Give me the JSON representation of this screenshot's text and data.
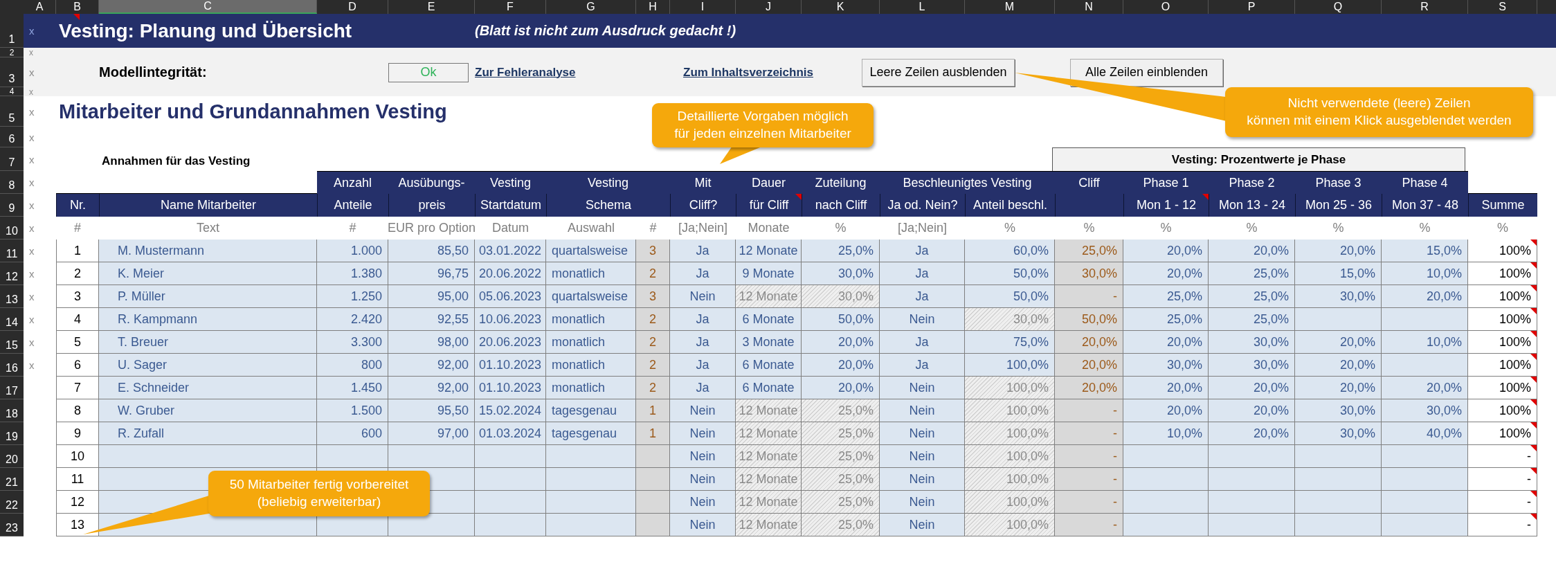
{
  "column_headers": [
    {
      "label": "A",
      "selected": false
    },
    {
      "label": "B",
      "selected": false
    },
    {
      "label": "C",
      "selected": true
    },
    {
      "label": "D",
      "selected": false
    },
    {
      "label": "E",
      "selected": false
    },
    {
      "label": "F",
      "selected": false
    },
    {
      "label": "G",
      "selected": false
    },
    {
      "label": "H",
      "selected": false
    },
    {
      "label": "I",
      "selected": false
    },
    {
      "label": "J",
      "selected": false
    },
    {
      "label": "K",
      "selected": false
    },
    {
      "label": "L",
      "selected": false
    },
    {
      "label": "M",
      "selected": false
    },
    {
      "label": "N",
      "selected": false
    },
    {
      "label": "O",
      "selected": false
    },
    {
      "label": "P",
      "selected": false
    },
    {
      "label": "Q",
      "selected": false
    },
    {
      "label": "R",
      "selected": false
    },
    {
      "label": "S",
      "selected": false
    }
  ],
  "row_headers": [
    {
      "label": "1",
      "marker": "x"
    },
    {
      "label": "2",
      "marker": "x"
    },
    {
      "label": "3",
      "marker": "x"
    },
    {
      "label": "4",
      "marker": "x"
    },
    {
      "label": "5",
      "marker": "x"
    },
    {
      "label": "6",
      "marker": "x"
    },
    {
      "label": "7",
      "marker": "x"
    },
    {
      "label": "8",
      "marker": "x"
    },
    {
      "label": "9",
      "marker": "x"
    },
    {
      "label": "10",
      "marker": "x"
    },
    {
      "label": "11",
      "marker": "x"
    },
    {
      "label": "12",
      "marker": "x"
    },
    {
      "label": "13",
      "marker": "x"
    },
    {
      "label": "14",
      "marker": "x"
    },
    {
      "label": "15",
      "marker": "x"
    },
    {
      "label": "16",
      "marker": "x"
    },
    {
      "label": "17"
    },
    {
      "label": "18"
    },
    {
      "label": "19"
    },
    {
      "label": "20"
    },
    {
      "label": "21"
    },
    {
      "label": "22"
    },
    {
      "label": "23"
    }
  ],
  "title_comment": true,
  "title": "Vesting: Planung und Übersicht",
  "subtitle": "(Blatt ist nicht zum Ausdruck gedacht !)",
  "controls": {
    "label": "Modellintegrität:",
    "status": "Ok",
    "links": [
      "Zur Fehleranalyse",
      "Zum Inhaltsverzeichnis"
    ],
    "buttons": [
      "Leere Zeilen ausblenden",
      "Alle Zeilen einblenden"
    ]
  },
  "section_title": "Mitarbeiter und Grundannahmen Vesting",
  "subsection_title": "Annahmen für das Vesting",
  "phase_group_title": "Vesting: Prozentwerte je Phase",
  "table": {
    "header_groups": [
      {
        "columns": [
          {
            "label": "Nr.",
            "comment": false
          }
        ]
      },
      {
        "columns": [
          {
            "label": "Name Mitarbeiter",
            "comment": false
          }
        ]
      },
      {
        "top": "Anzahl",
        "columns": [
          {
            "label": "Anteile",
            "comment": false
          }
        ]
      },
      {
        "top": "Ausübungs-",
        "columns": [
          {
            "label": "preis",
            "comment": false
          }
        ]
      },
      {
        "top": "Vesting",
        "columns": [
          {
            "label": "Startdatum",
            "comment": false
          }
        ]
      },
      {
        "top": "Vesting",
        "columns": [
          {
            "label": "Schema",
            "comment": false
          }
        ]
      },
      {
        "top": "Mit",
        "columns": [
          {
            "label": "Cliff?",
            "comment": false
          }
        ]
      },
      {
        "top": "Dauer",
        "columns": [
          {
            "label": "für Cliff",
            "comment": true
          }
        ]
      },
      {
        "top": "Zuteilung",
        "columns": [
          {
            "label": "nach Cliff",
            "comment": false
          }
        ]
      },
      {
        "top": "Beschleunigtes Vesting",
        "columns": [
          {
            "label": "Ja od. Nein?",
            "comment": false
          },
          {
            "label": "Anteil beschl.",
            "comment": false
          }
        ]
      },
      {
        "top": "Cliff"
      },
      {
        "top": "Phase 1",
        "columns": [
          {
            "label": "Mon 1 - 12",
            "comment": true
          }
        ]
      },
      {
        "top": "Phase 2",
        "columns": [
          {
            "label": "Mon 13 - 24",
            "comment": false
          }
        ]
      },
      {
        "top": "Phase 3",
        "columns": [
          {
            "label": "Mon 25 - 36",
            "comment": false
          }
        ]
      },
      {
        "top": "Phase 4",
        "columns": [
          {
            "label": "Mon 37 - 48",
            "comment": false
          }
        ]
      },
      {
        "columns": [
          {
            "label": "Summe",
            "comment": false
          }
        ]
      }
    ],
    "units": [
      "#",
      "Text",
      "#",
      "EUR pro Option",
      "Datum",
      "Auswahl",
      "#",
      "[Ja;Nein]",
      "Monate",
      "%",
      "[Ja;Nein]",
      "%",
      "%",
      "%",
      "%",
      "%",
      "%",
      "%"
    ],
    "rows": [
      {
        "nr": "1",
        "name": "M. Mustermann",
        "anteile": "1.000",
        "preis": "85,50",
        "datum": "03.01.2022",
        "schema": "quartalsweise",
        "stufen": "3",
        "cliff": "Ja",
        "dauer": "12 Monate",
        "zuteilung": "25,0%",
        "dauer_disabled": false,
        "beschleunigt": "Ja",
        "anteil": "60,0%",
        "anteil_disabled": false,
        "cliff_anteil": "25,0%",
        "phases": [
          "20,0%",
          "20,0%",
          "20,0%",
          "15,0%"
        ],
        "summe": "100%",
        "summe_comment": true
      },
      {
        "nr": "2",
        "name": "K. Meier",
        "anteile": "1.380",
        "preis": "96,75",
        "datum": "20.06.2022",
        "schema": "monatlich",
        "stufen": "2",
        "cliff": "Ja",
        "dauer": "9 Monate",
        "zuteilung": "30,0%",
        "dauer_disabled": false,
        "beschleunigt": "Ja",
        "anteil": "50,0%",
        "anteil_disabled": false,
        "cliff_anteil": "30,0%",
        "phases": [
          "20,0%",
          "25,0%",
          "15,0%",
          "10,0%"
        ],
        "summe": "100%",
        "summe_comment": true
      },
      {
        "nr": "3",
        "name": "P. Müller",
        "anteile": "1.250",
        "preis": "95,00",
        "datum": "05.06.2023",
        "schema": "quartalsweise",
        "stufen": "3",
        "cliff": "Nein",
        "dauer": "12 Monate",
        "zuteilung": "30,0%",
        "dauer_disabled": true,
        "beschleunigt": "Ja",
        "anteil": "50,0%",
        "anteil_disabled": false,
        "cliff_anteil": "-",
        "phases": [
          "25,0%",
          "25,0%",
          "30,0%",
          "20,0%"
        ],
        "summe": "100%",
        "summe_comment": true
      },
      {
        "nr": "4",
        "name": "R. Kampmann",
        "anteile": "2.420",
        "preis": "92,55",
        "datum": "10.06.2023",
        "schema": "monatlich",
        "stufen": "2",
        "cliff": "Ja",
        "dauer": "6 Monate",
        "zuteilung": "50,0%",
        "dauer_disabled": false,
        "beschleunigt": "Nein",
        "anteil": "30,0%",
        "anteil_disabled": true,
        "cliff_anteil": "50,0%",
        "phases": [
          "25,0%",
          "25,0%"
        ],
        "summe": "100%",
        "summe_comment": true
      },
      {
        "nr": "5",
        "name": "T. Breuer",
        "anteile": "3.300",
        "preis": "98,00",
        "datum": "20.06.2023",
        "schema": "monatlich",
        "stufen": "2",
        "cliff": "Ja",
        "dauer": "3 Monate",
        "zuteilung": "20,0%",
        "dauer_disabled": false,
        "beschleunigt": "Ja",
        "anteil": "75,0%",
        "anteil_disabled": false,
        "cliff_anteil": "20,0%",
        "phases": [
          "20,0%",
          "30,0%",
          "20,0%",
          "10,0%"
        ],
        "summe": "100%",
        "summe_comment": true
      },
      {
        "nr": "6",
        "name": "U. Sager",
        "anteile": "800",
        "preis": "92,00",
        "datum": "01.10.2023",
        "schema": "monatlich",
        "stufen": "2",
        "cliff": "Ja",
        "dauer": "6 Monate",
        "zuteilung": "20,0%",
        "dauer_disabled": false,
        "beschleunigt": "Ja",
        "anteil": "100,0%",
        "anteil_disabled": false,
        "cliff_anteil": "20,0%",
        "phases": [
          "30,0%",
          "30,0%",
          "20,0%"
        ],
        "summe": "100%",
        "summe_comment": true
      },
      {
        "nr": "7",
        "name": "E. Schneider",
        "anteile": "1.450",
        "preis": "92,00",
        "datum": "01.10.2023",
        "schema": "monatlich",
        "stufen": "2",
        "cliff": "Ja",
        "dauer": "6 Monate",
        "zuteilung": "20,0%",
        "dauer_disabled": false,
        "beschleunigt": "Nein",
        "anteil": "100,0%",
        "anteil_disabled": true,
        "cliff_anteil": "20,0%",
        "phases": [
          "20,0%",
          "20,0%",
          "20,0%",
          "20,0%"
        ],
        "summe": "100%",
        "summe_comment": true
      },
      {
        "nr": "8",
        "name": "W. Gruber",
        "anteile": "1.500",
        "preis": "95,50",
        "datum": "15.02.2024",
        "schema": "tagesgenau",
        "stufen": "1",
        "cliff": "Nein",
        "dauer": "12 Monate",
        "zuteilung": "25,0%",
        "dauer_disabled": true,
        "beschleunigt": "Nein",
        "anteil": "100,0%",
        "anteil_disabled": true,
        "cliff_anteil": "-",
        "phases": [
          "20,0%",
          "20,0%",
          "30,0%",
          "30,0%"
        ],
        "summe": "100%",
        "summe_comment": true
      },
      {
        "nr": "9",
        "name": "R. Zufall",
        "anteile": "600",
        "preis": "97,00",
        "datum": "01.03.2024",
        "schema": "tagesgenau",
        "stufen": "1",
        "cliff": "Nein",
        "dauer": "12 Monate",
        "zuteilung": "25,0%",
        "dauer_disabled": true,
        "beschleunigt": "Nein",
        "anteil": "100,0%",
        "anteil_disabled": true,
        "cliff_anteil": "-",
        "phases": [
          "10,0%",
          "20,0%",
          "30,0%",
          "40,0%"
        ],
        "summe": "100%",
        "summe_comment": true
      },
      {
        "nr": "10",
        "cliff": "Nein",
        "dauer": "12 Monate",
        "zuteilung": "25,0%",
        "dauer_disabled": true,
        "beschleunigt": "Nein",
        "anteil": "100,0%",
        "anteil_disabled": true,
        "cliff_anteil": "-",
        "summe": "-",
        "summe_comment": true
      },
      {
        "nr": "11",
        "cliff": "Nein",
        "dauer": "12 Monate",
        "zuteilung": "25,0%",
        "dauer_disabled": true,
        "beschleunigt": "Nein",
        "anteil": "100,0%",
        "anteil_disabled": true,
        "cliff_anteil": "-",
        "summe": "-",
        "summe_comment": true
      },
      {
        "nr": "12",
        "cliff": "Nein",
        "dauer": "12 Monate",
        "zuteilung": "25,0%",
        "dauer_disabled": true,
        "beschleunigt": "Nein",
        "anteil": "100,0%",
        "anteil_disabled": true,
        "cliff_anteil": "-",
        "summe": "-",
        "summe_comment": true
      },
      {
        "nr": "13",
        "cliff": "Nein",
        "dauer": "12 Monate",
        "zuteilung": "25,0%",
        "dauer_disabled": true,
        "beschleunigt": "Nein",
        "anteil": "100,0%",
        "anteil_disabled": true,
        "cliff_anteil": "-",
        "summe": "-",
        "summe_comment": true
      }
    ]
  },
  "callouts": [
    {
      "text": "Detaillierte Vorgaben möglich\nfür jeden einzelnen Mitarbeiter"
    },
    {
      "text": "Nicht verwendete (leere) Zeilen\nkönnen mit einem Klick ausgeblendet werden"
    },
    {
      "text": "50 Mitarbeiter fertig vorbereitet\n(beliebig erweiterbar)"
    }
  ]
}
